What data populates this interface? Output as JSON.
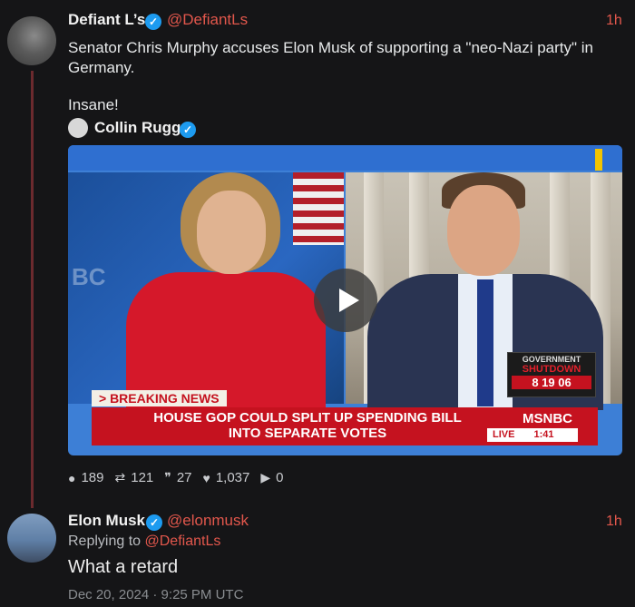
{
  "tweet1": {
    "name": "Defiant L’s",
    "handle": "@DefiantLs",
    "time": "1h",
    "text_line1": "Senator Chris Murphy accuses Elon Musk of supporting a \"neo-Nazi party\" in",
    "text_line2": "Germany.",
    "text_line3": "Insane!",
    "quoted_name": "Collin Rugg",
    "video": {
      "breaking_label": "> BREAKING NEWS",
      "headline_line1": "HOUSE GOP COULD SPLIT UP SPENDING BILL",
      "headline_line2": "INTO SEPARATE VOTES",
      "network": "MSNBC",
      "live_label": "LIVE",
      "clock": "1:41",
      "shutdown_title": "GOVERNMENT",
      "shutdown_word": "SHUTDOWN",
      "countdown": "8 19 06",
      "ghost_logo": "BC"
    },
    "actions": {
      "replies": "189",
      "retweets": "121",
      "quotes": "27",
      "likes": "1,037",
      "views": "0"
    }
  },
  "tweet2": {
    "name": "Elon Musk",
    "handle": "@elonmusk",
    "time": "1h",
    "replying_prefix": "Replying to",
    "replying_handle": "@DefiantLs",
    "text": "What a retard",
    "date": "Dec 20, 2024 · 9:25 PM UTC"
  },
  "icons": {
    "verified": "verified-check-icon",
    "reply": "speech-bubble-icon",
    "retweet": "retweet-icon",
    "quote": "quote-icon",
    "like": "heart-icon",
    "play": "play-icon"
  },
  "colors": {
    "background": "#151517",
    "accent": "#e2574c",
    "verified": "#1d9bf0",
    "thread_line": "#6b2a2e"
  }
}
